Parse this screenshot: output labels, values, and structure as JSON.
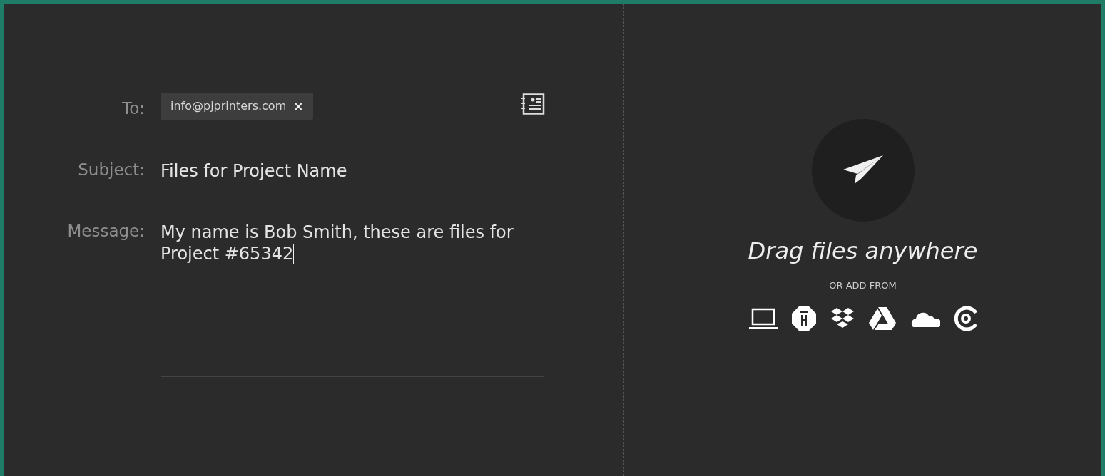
{
  "form": {
    "to": {
      "label": "To:",
      "recipients": [
        {
          "address": "info@pjprinters.com",
          "remove": "×"
        }
      ]
    },
    "subject": {
      "label": "Subject:",
      "value": "Files for Project Name"
    },
    "message": {
      "label": "Message:",
      "value": "My name is Bob Smith, these are files for Project #65342"
    }
  },
  "upload": {
    "heading": "Drag files anywhere",
    "sources_label": "OR ADD FROM",
    "sources": [
      {
        "kind": "computer"
      },
      {
        "kind": "octagon"
      },
      {
        "kind": "boxes"
      },
      {
        "kind": "drive"
      },
      {
        "kind": "cloud"
      },
      {
        "kind": "ring"
      }
    ]
  }
}
